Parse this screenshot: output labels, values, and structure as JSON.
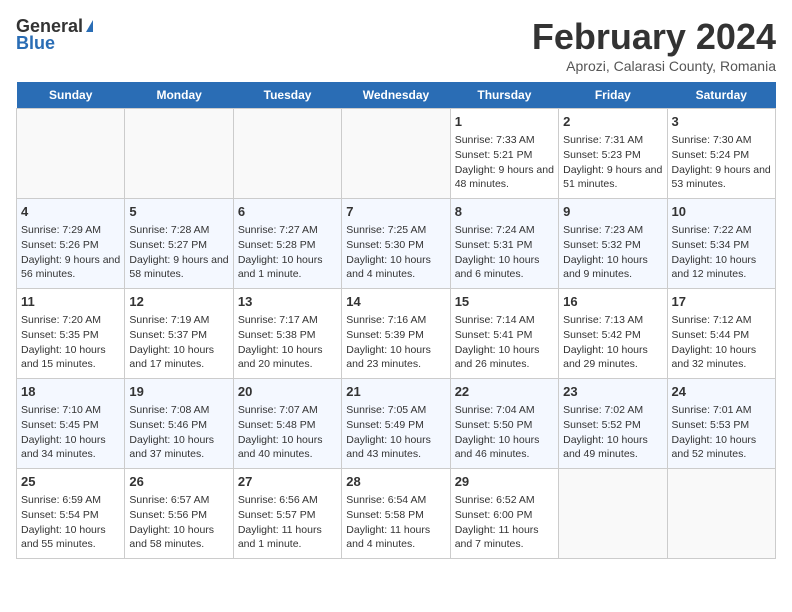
{
  "header": {
    "logo_general": "General",
    "logo_blue": "Blue",
    "month_title": "February 2024",
    "subtitle": "Aprozi, Calarasi County, Romania"
  },
  "days_of_week": [
    "Sunday",
    "Monday",
    "Tuesday",
    "Wednesday",
    "Thursday",
    "Friday",
    "Saturday"
  ],
  "weeks": [
    [
      {
        "day": null,
        "content": null
      },
      {
        "day": null,
        "content": null
      },
      {
        "day": null,
        "content": null
      },
      {
        "day": null,
        "content": null
      },
      {
        "day": "1",
        "sunrise": "7:33 AM",
        "sunset": "5:21 PM",
        "daylight": "9 hours and 48 minutes."
      },
      {
        "day": "2",
        "sunrise": "7:31 AM",
        "sunset": "5:23 PM",
        "daylight": "9 hours and 51 minutes."
      },
      {
        "day": "3",
        "sunrise": "7:30 AM",
        "sunset": "5:24 PM",
        "daylight": "9 hours and 53 minutes."
      }
    ],
    [
      {
        "day": "4",
        "sunrise": "7:29 AM",
        "sunset": "5:26 PM",
        "daylight": "9 hours and 56 minutes."
      },
      {
        "day": "5",
        "sunrise": "7:28 AM",
        "sunset": "5:27 PM",
        "daylight": "9 hours and 58 minutes."
      },
      {
        "day": "6",
        "sunrise": "7:27 AM",
        "sunset": "5:28 PM",
        "daylight": "10 hours and 1 minute."
      },
      {
        "day": "7",
        "sunrise": "7:25 AM",
        "sunset": "5:30 PM",
        "daylight": "10 hours and 4 minutes."
      },
      {
        "day": "8",
        "sunrise": "7:24 AM",
        "sunset": "5:31 PM",
        "daylight": "10 hours and 6 minutes."
      },
      {
        "day": "9",
        "sunrise": "7:23 AM",
        "sunset": "5:32 PM",
        "daylight": "10 hours and 9 minutes."
      },
      {
        "day": "10",
        "sunrise": "7:22 AM",
        "sunset": "5:34 PM",
        "daylight": "10 hours and 12 minutes."
      }
    ],
    [
      {
        "day": "11",
        "sunrise": "7:20 AM",
        "sunset": "5:35 PM",
        "daylight": "10 hours and 15 minutes."
      },
      {
        "day": "12",
        "sunrise": "7:19 AM",
        "sunset": "5:37 PM",
        "daylight": "10 hours and 17 minutes."
      },
      {
        "day": "13",
        "sunrise": "7:17 AM",
        "sunset": "5:38 PM",
        "daylight": "10 hours and 20 minutes."
      },
      {
        "day": "14",
        "sunrise": "7:16 AM",
        "sunset": "5:39 PM",
        "daylight": "10 hours and 23 minutes."
      },
      {
        "day": "15",
        "sunrise": "7:14 AM",
        "sunset": "5:41 PM",
        "daylight": "10 hours and 26 minutes."
      },
      {
        "day": "16",
        "sunrise": "7:13 AM",
        "sunset": "5:42 PM",
        "daylight": "10 hours and 29 minutes."
      },
      {
        "day": "17",
        "sunrise": "7:12 AM",
        "sunset": "5:44 PM",
        "daylight": "10 hours and 32 minutes."
      }
    ],
    [
      {
        "day": "18",
        "sunrise": "7:10 AM",
        "sunset": "5:45 PM",
        "daylight": "10 hours and 34 minutes."
      },
      {
        "day": "19",
        "sunrise": "7:08 AM",
        "sunset": "5:46 PM",
        "daylight": "10 hours and 37 minutes."
      },
      {
        "day": "20",
        "sunrise": "7:07 AM",
        "sunset": "5:48 PM",
        "daylight": "10 hours and 40 minutes."
      },
      {
        "day": "21",
        "sunrise": "7:05 AM",
        "sunset": "5:49 PM",
        "daylight": "10 hours and 43 minutes."
      },
      {
        "day": "22",
        "sunrise": "7:04 AM",
        "sunset": "5:50 PM",
        "daylight": "10 hours and 46 minutes."
      },
      {
        "day": "23",
        "sunrise": "7:02 AM",
        "sunset": "5:52 PM",
        "daylight": "10 hours and 49 minutes."
      },
      {
        "day": "24",
        "sunrise": "7:01 AM",
        "sunset": "5:53 PM",
        "daylight": "10 hours and 52 minutes."
      }
    ],
    [
      {
        "day": "25",
        "sunrise": "6:59 AM",
        "sunset": "5:54 PM",
        "daylight": "10 hours and 55 minutes."
      },
      {
        "day": "26",
        "sunrise": "6:57 AM",
        "sunset": "5:56 PM",
        "daylight": "10 hours and 58 minutes."
      },
      {
        "day": "27",
        "sunrise": "6:56 AM",
        "sunset": "5:57 PM",
        "daylight": "11 hours and 1 minute."
      },
      {
        "day": "28",
        "sunrise": "6:54 AM",
        "sunset": "5:58 PM",
        "daylight": "11 hours and 4 minutes."
      },
      {
        "day": "29",
        "sunrise": "6:52 AM",
        "sunset": "6:00 PM",
        "daylight": "11 hours and 7 minutes."
      },
      {
        "day": null,
        "content": null
      },
      {
        "day": null,
        "content": null
      }
    ]
  ],
  "labels": {
    "sunrise": "Sunrise:",
    "sunset": "Sunset:",
    "daylight": "Daylight:"
  }
}
